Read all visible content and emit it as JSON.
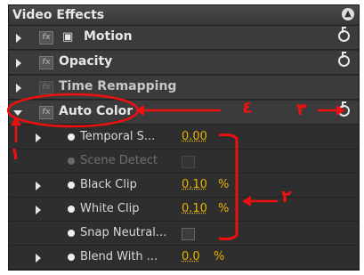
{
  "panel": {
    "title": "Video Effects",
    "collapse_icon": "chevron-up-circle-icon"
  },
  "effects": [
    {
      "label": "Motion",
      "expanded": false,
      "has_reset": true
    },
    {
      "label": "Opacity",
      "expanded": false,
      "has_reset": true
    },
    {
      "label": "Time Remapping",
      "expanded": false,
      "has_reset": false
    },
    {
      "label": "Auto Color",
      "expanded": true,
      "has_reset": true
    }
  ],
  "parameters": [
    {
      "label": "Temporal S...",
      "value": "0.00",
      "unit": ""
    },
    {
      "label": "Scene Detect",
      "type": "checkbox",
      "disabled": true
    },
    {
      "label": "Black Clip",
      "value": "0.10",
      "unit": "%"
    },
    {
      "label": "White Clip",
      "value": "0.10",
      "unit": "%"
    },
    {
      "label": "Snap Neutral...",
      "type": "checkbox"
    },
    {
      "label": "Blend With ...",
      "value": "0.0",
      "unit": "%"
    }
  ],
  "annotations": {
    "one": "١",
    "two": "٢",
    "three": "٣",
    "four": "٤",
    "color": "#ee1010"
  },
  "colors": {
    "value_color": "#e8b400",
    "panel_bg": "#2a2a2a"
  }
}
